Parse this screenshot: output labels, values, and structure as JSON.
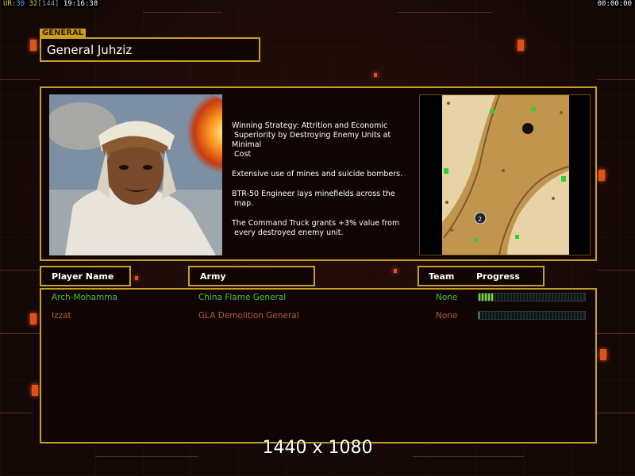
{
  "topbar": {
    "left_segments": [
      {
        "text": "UR:",
        "color": "yellow"
      },
      {
        "text": "30",
        "color": "blue"
      },
      {
        "text": " 32",
        "color": "yellow"
      },
      {
        "text": "[144]",
        "color": "grey"
      },
      {
        "text": " 19:16:38",
        "color": "white"
      }
    ],
    "right_time": "00:00:00"
  },
  "general": {
    "tag": "GENERAL",
    "name": "General Juhziz"
  },
  "strategy": [
    "Winning Strategy: Attrition and Economic\n Superiority by Destroying Enemy Units at Minimal\n Cost",
    "Extensive use of mines and suicide bombers.",
    "BTR-50 Engineer lays minefields across the\n map.",
    "The Command Truck grants +3% value from\n every destroyed enemy unit."
  ],
  "columns": {
    "player_name": "Player Name",
    "army": "Army",
    "team": "Team",
    "progress": "Progress"
  },
  "players": [
    {
      "name": "Arch-Mohamma",
      "army": "China Flame General",
      "team": "None",
      "progress": 0.14,
      "color": "#3ec83e"
    },
    {
      "name": "Izzat",
      "army": "GLA Demolition General",
      "team": "None",
      "progress": 0.01,
      "color": "#b85c3c"
    }
  ],
  "resolution_text": "1440 x 1080",
  "colors": {
    "frame": "#c8a020",
    "background": "#120807",
    "accent_squares": "#e0501c"
  }
}
